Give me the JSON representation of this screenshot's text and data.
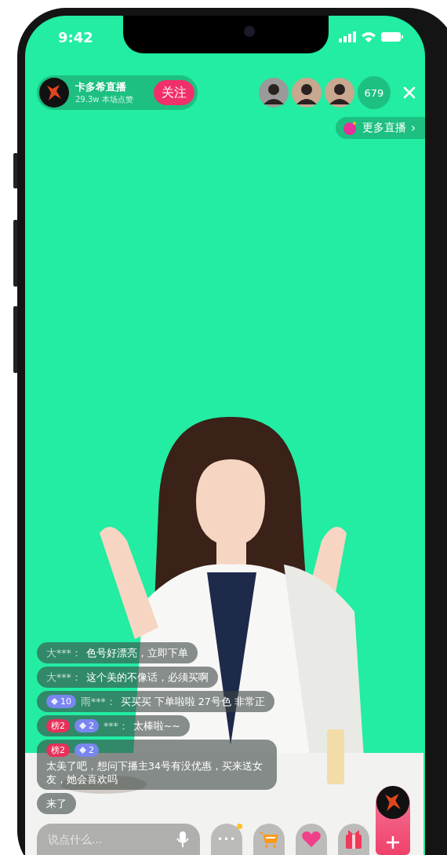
{
  "status_bar": {
    "time": "9:42"
  },
  "host": {
    "name": "卡多希直播",
    "stats": "29.3w 本场点赞",
    "follow_button": "关注"
  },
  "viewers": {
    "count": "679"
  },
  "more_live": {
    "label": "更多直播",
    "arrow": "›"
  },
  "comments": [
    {
      "user": "大***：",
      "text": "色号好漂亮，立即下单"
    },
    {
      "user": "大***：",
      "text": "这个美的不像话，必须买啊"
    },
    {
      "badges": [
        {
          "kind": "fan",
          "text": "10"
        }
      ],
      "user": "雨***：",
      "text": "买买买 下单啦啦 27号色 非常正"
    },
    {
      "badges": [
        {
          "kind": "rank",
          "text": "榜2"
        },
        {
          "kind": "fan",
          "text": "2"
        }
      ],
      "user": "***：",
      "text": "太棒啦~~"
    },
    {
      "badges": [
        {
          "kind": "rank",
          "text": "榜2"
        },
        {
          "kind": "fan",
          "text": "2"
        }
      ],
      "text": "太美了吧，想问下播主34号有没优惠，买来送女友，她会喜欢吗"
    },
    {
      "text": "来了"
    }
  ],
  "input": {
    "placeholder": "说点什么..."
  },
  "more_button": {
    "label": "•••",
    "has_notification": true
  }
}
